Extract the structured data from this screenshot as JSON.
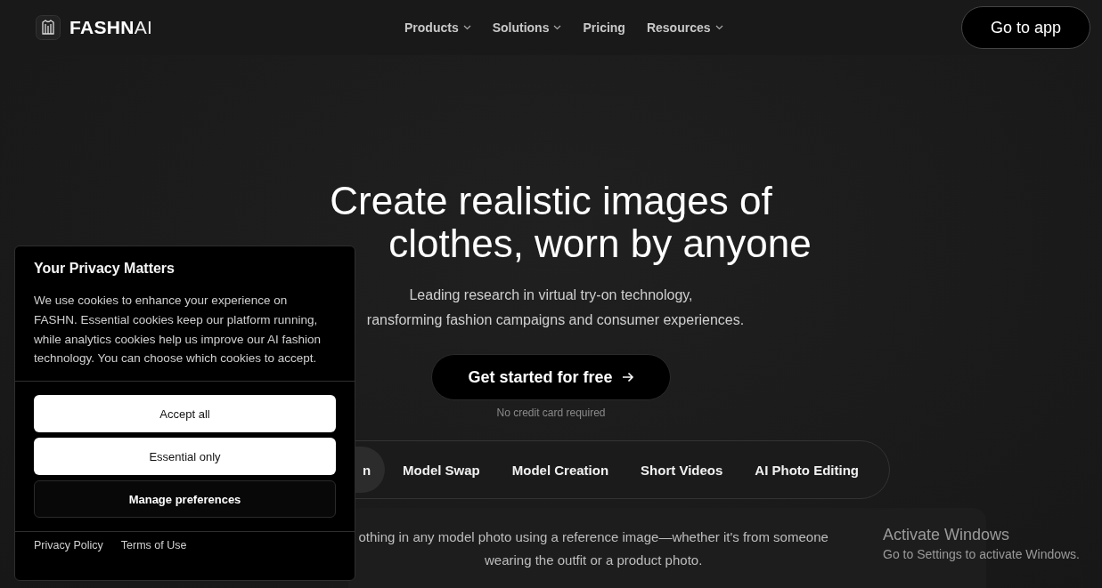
{
  "header": {
    "logo": {
      "bold": "FASHN",
      "light": "AI"
    },
    "nav": [
      {
        "label": "Products",
        "dropdown": true
      },
      {
        "label": "Solutions",
        "dropdown": true
      },
      {
        "label": "Pricing",
        "dropdown": false
      },
      {
        "label": "Resources",
        "dropdown": true
      }
    ],
    "cta": "Go to app"
  },
  "hero": {
    "title_lines": [
      "Create realistic images of",
      "clothes, worn by anyone"
    ],
    "subtitle_lines": [
      "Leading research in virtual try-on technology,",
      "ransforming fashion campaigns and consumer experiences."
    ],
    "cta": "Get started for free",
    "cta_note": "No credit card required"
  },
  "tabs": [
    {
      "label": "n",
      "selected": true
    },
    {
      "label": "Model Swap",
      "selected": false
    },
    {
      "label": "Model Creation",
      "selected": false
    },
    {
      "label": "Short Videos",
      "selected": false
    },
    {
      "label": "AI Photo Editing",
      "selected": false
    }
  ],
  "description_lines": [
    "othing in any model photo using a reference image—whether it's from someone",
    "wearing the outfit or a product photo."
  ],
  "cookie_dialog": {
    "title": "Your Privacy Matters",
    "body": "We use cookies to enhance your experience on FASHN. Essential cookies keep our platform running, while analytics cookies help us improve our AI fashion technology. You can choose which cookies to accept.",
    "buttons": [
      {
        "label": "Accept all",
        "kind": "primary"
      },
      {
        "label": "Essential only",
        "kind": "primary"
      },
      {
        "label": "Manage preferences",
        "kind": "secondary"
      }
    ],
    "links": [
      "Privacy Policy",
      "Terms of Use"
    ]
  },
  "os_notice": {
    "title": "Activate Windows",
    "text": "Go to Settings to activate Windows."
  }
}
